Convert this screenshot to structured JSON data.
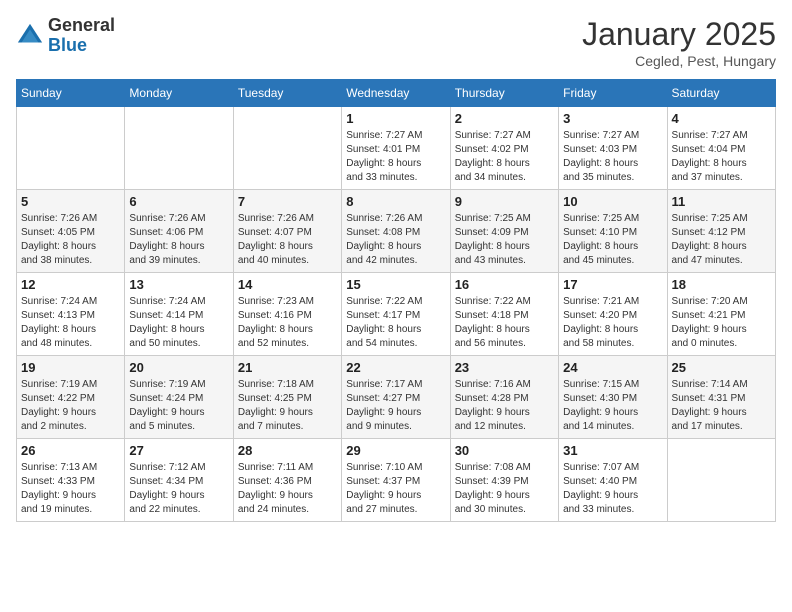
{
  "header": {
    "logo": {
      "line1": "General",
      "line2": "Blue"
    },
    "month": "January 2025",
    "location": "Cegled, Pest, Hungary"
  },
  "weekdays": [
    "Sunday",
    "Monday",
    "Tuesday",
    "Wednesday",
    "Thursday",
    "Friday",
    "Saturday"
  ],
  "weeks": [
    [
      {
        "day": "",
        "info": ""
      },
      {
        "day": "",
        "info": ""
      },
      {
        "day": "",
        "info": ""
      },
      {
        "day": "1",
        "info": "Sunrise: 7:27 AM\nSunset: 4:01 PM\nDaylight: 8 hours\nand 33 minutes."
      },
      {
        "day": "2",
        "info": "Sunrise: 7:27 AM\nSunset: 4:02 PM\nDaylight: 8 hours\nand 34 minutes."
      },
      {
        "day": "3",
        "info": "Sunrise: 7:27 AM\nSunset: 4:03 PM\nDaylight: 8 hours\nand 35 minutes."
      },
      {
        "day": "4",
        "info": "Sunrise: 7:27 AM\nSunset: 4:04 PM\nDaylight: 8 hours\nand 37 minutes."
      }
    ],
    [
      {
        "day": "5",
        "info": "Sunrise: 7:26 AM\nSunset: 4:05 PM\nDaylight: 8 hours\nand 38 minutes."
      },
      {
        "day": "6",
        "info": "Sunrise: 7:26 AM\nSunset: 4:06 PM\nDaylight: 8 hours\nand 39 minutes."
      },
      {
        "day": "7",
        "info": "Sunrise: 7:26 AM\nSunset: 4:07 PM\nDaylight: 8 hours\nand 40 minutes."
      },
      {
        "day": "8",
        "info": "Sunrise: 7:26 AM\nSunset: 4:08 PM\nDaylight: 8 hours\nand 42 minutes."
      },
      {
        "day": "9",
        "info": "Sunrise: 7:25 AM\nSunset: 4:09 PM\nDaylight: 8 hours\nand 43 minutes."
      },
      {
        "day": "10",
        "info": "Sunrise: 7:25 AM\nSunset: 4:10 PM\nDaylight: 8 hours\nand 45 minutes."
      },
      {
        "day": "11",
        "info": "Sunrise: 7:25 AM\nSunset: 4:12 PM\nDaylight: 8 hours\nand 47 minutes."
      }
    ],
    [
      {
        "day": "12",
        "info": "Sunrise: 7:24 AM\nSunset: 4:13 PM\nDaylight: 8 hours\nand 48 minutes."
      },
      {
        "day": "13",
        "info": "Sunrise: 7:24 AM\nSunset: 4:14 PM\nDaylight: 8 hours\nand 50 minutes."
      },
      {
        "day": "14",
        "info": "Sunrise: 7:23 AM\nSunset: 4:16 PM\nDaylight: 8 hours\nand 52 minutes."
      },
      {
        "day": "15",
        "info": "Sunrise: 7:22 AM\nSunset: 4:17 PM\nDaylight: 8 hours\nand 54 minutes."
      },
      {
        "day": "16",
        "info": "Sunrise: 7:22 AM\nSunset: 4:18 PM\nDaylight: 8 hours\nand 56 minutes."
      },
      {
        "day": "17",
        "info": "Sunrise: 7:21 AM\nSunset: 4:20 PM\nDaylight: 8 hours\nand 58 minutes."
      },
      {
        "day": "18",
        "info": "Sunrise: 7:20 AM\nSunset: 4:21 PM\nDaylight: 9 hours\nand 0 minutes."
      }
    ],
    [
      {
        "day": "19",
        "info": "Sunrise: 7:19 AM\nSunset: 4:22 PM\nDaylight: 9 hours\nand 2 minutes."
      },
      {
        "day": "20",
        "info": "Sunrise: 7:19 AM\nSunset: 4:24 PM\nDaylight: 9 hours\nand 5 minutes."
      },
      {
        "day": "21",
        "info": "Sunrise: 7:18 AM\nSunset: 4:25 PM\nDaylight: 9 hours\nand 7 minutes."
      },
      {
        "day": "22",
        "info": "Sunrise: 7:17 AM\nSunset: 4:27 PM\nDaylight: 9 hours\nand 9 minutes."
      },
      {
        "day": "23",
        "info": "Sunrise: 7:16 AM\nSunset: 4:28 PM\nDaylight: 9 hours\nand 12 minutes."
      },
      {
        "day": "24",
        "info": "Sunrise: 7:15 AM\nSunset: 4:30 PM\nDaylight: 9 hours\nand 14 minutes."
      },
      {
        "day": "25",
        "info": "Sunrise: 7:14 AM\nSunset: 4:31 PM\nDaylight: 9 hours\nand 17 minutes."
      }
    ],
    [
      {
        "day": "26",
        "info": "Sunrise: 7:13 AM\nSunset: 4:33 PM\nDaylight: 9 hours\nand 19 minutes."
      },
      {
        "day": "27",
        "info": "Sunrise: 7:12 AM\nSunset: 4:34 PM\nDaylight: 9 hours\nand 22 minutes."
      },
      {
        "day": "28",
        "info": "Sunrise: 7:11 AM\nSunset: 4:36 PM\nDaylight: 9 hours\nand 24 minutes."
      },
      {
        "day": "29",
        "info": "Sunrise: 7:10 AM\nSunset: 4:37 PM\nDaylight: 9 hours\nand 27 minutes."
      },
      {
        "day": "30",
        "info": "Sunrise: 7:08 AM\nSunset: 4:39 PM\nDaylight: 9 hours\nand 30 minutes."
      },
      {
        "day": "31",
        "info": "Sunrise: 7:07 AM\nSunset: 4:40 PM\nDaylight: 9 hours\nand 33 minutes."
      },
      {
        "day": "",
        "info": ""
      }
    ]
  ]
}
